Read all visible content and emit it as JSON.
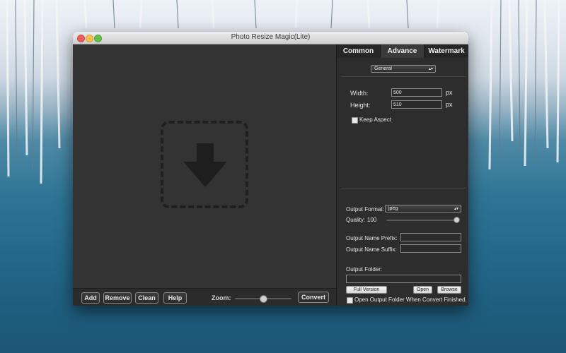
{
  "window": {
    "title": "Photo Resize Magic(Lite)"
  },
  "toolbar": {
    "add_label": "Add",
    "remove_label": "Remove",
    "clean_label": "Clean",
    "help_label": "Help",
    "zoom_label": "Zoom:",
    "convert_label": "Convert",
    "zoom_level": 0.5
  },
  "tabs": [
    {
      "label": "Common",
      "active": false
    },
    {
      "label": "Advance",
      "active": true
    },
    {
      "label": "Watermark",
      "active": false
    }
  ],
  "resize": {
    "mode": "General",
    "width_label": "Width:",
    "width_value": "500",
    "height_label": "Height:",
    "height_value": "510",
    "unit": "px",
    "keep_aspect_label": "Keep Aspect",
    "keep_aspect_checked": false
  },
  "output": {
    "format_label": "Output Format:",
    "format_value": "jpeg",
    "quality_label": "Quality:",
    "quality_value": "100",
    "prefix_label": "Output Name Prefix:",
    "prefix_value": "",
    "suffix_label": "Output Name Suffix:",
    "suffix_value": "",
    "folder_label": "Output Folder:",
    "folder_value": "",
    "full_version_label": "Full Version",
    "open_label": "Open",
    "browse_label": "Browse",
    "open_when_finished_label": "Open Output Folder When Convert Finished.",
    "open_when_finished_checked": false
  },
  "colors": {
    "panel": "#2f2f2f",
    "accent_text": "#e6e6e6"
  }
}
